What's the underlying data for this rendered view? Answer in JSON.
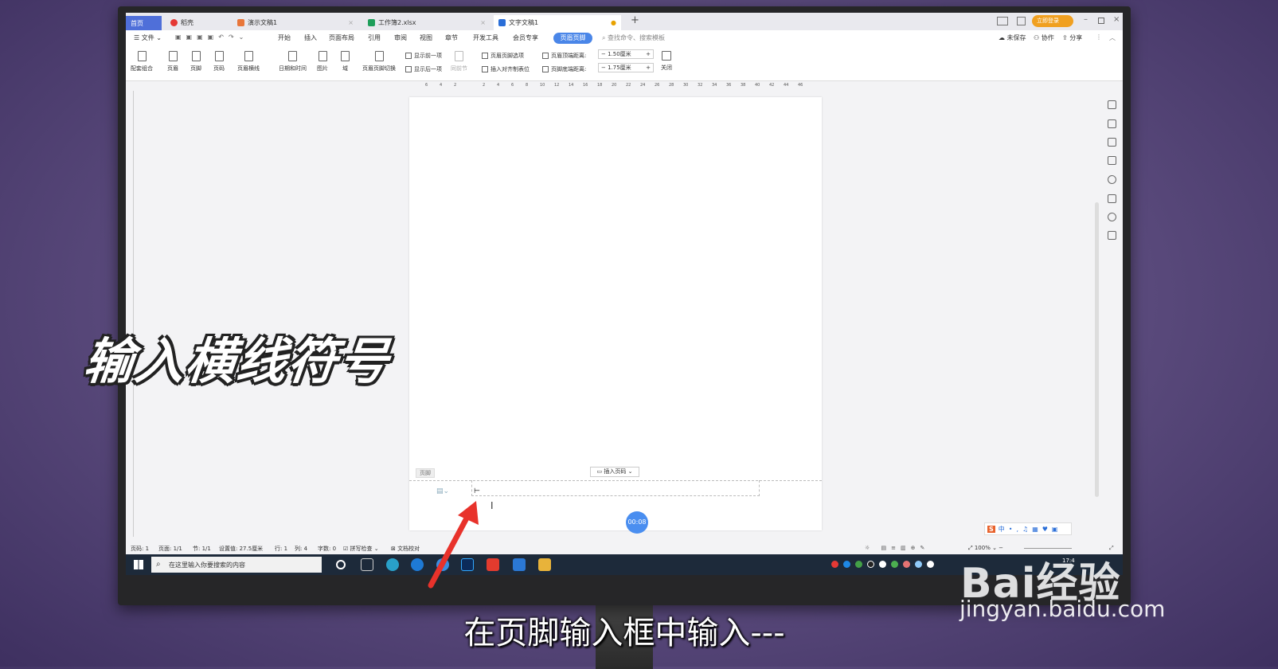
{
  "tabs": [
    {
      "label": "首页",
      "color": "#4f6fd9"
    },
    {
      "label": "稻壳",
      "color": "#e53935"
    },
    {
      "label": "演示文稿1",
      "color": "#e8763a"
    },
    {
      "label": "工作簿2.xlsx",
      "color": "#1e9e5a"
    },
    {
      "label": "文字文稿1",
      "color": "#2a6ed8"
    }
  ],
  "titlebar": {
    "login_label": "立即登录",
    "new_tab": "+"
  },
  "menu": {
    "file": "文件",
    "items": [
      "开始",
      "插入",
      "页面布局",
      "引用",
      "审阅",
      "视图",
      "章节",
      "开发工具",
      "会员专享"
    ],
    "active_tab": "页眉页脚",
    "search": "查找命令、搜索模板",
    "unsaved": "未保存",
    "collab": "协作",
    "share": "分享"
  },
  "ribbon": {
    "big_buttons": [
      "配套组合",
      "页眉",
      "页脚",
      "页码",
      "页眉横线",
      "日期和时间",
      "图片",
      "域",
      "页眉页脚切换"
    ],
    "show_prev": "显示前一项",
    "show_next": "显示后一项",
    "same_prev": "同前节",
    "hf_options": "页眉页脚选项",
    "insert_align_tab": "插入对齐制表位",
    "header_top_label": "页眉顶端距离:",
    "header_top_value": "1.50厘米",
    "footer_bottom_label": "页脚底端距离:",
    "footer_bottom_value": "1.75厘米",
    "close": "关闭"
  },
  "ruler_ticks": [
    "6",
    "4",
    "2",
    "2",
    "4",
    "6",
    "8",
    "10",
    "12",
    "14",
    "16",
    "18",
    "20",
    "22",
    "24",
    "26",
    "28",
    "30",
    "32",
    "34",
    "36",
    "38",
    "40",
    "42",
    "44",
    "46"
  ],
  "document": {
    "footer_tag": "页脚",
    "insert_page_number": "插入页码",
    "timer": "00:08"
  },
  "statusbar": {
    "page_num": "页码: 1",
    "pages": "页面: 1/1",
    "section": "节: 1/1",
    "setting": "设置值: 27.5厘米",
    "row": "行: 1",
    "col": "列: 4",
    "words": "字数: 0",
    "spell": "拼写检查",
    "proof": "文档校对",
    "zoom": "100%"
  },
  "taskbar": {
    "search_placeholder": "在这里输入你要搜索的内容",
    "time": "17:4"
  },
  "overlay": {
    "title": "输入横线符号",
    "subtitle": "在页脚输入框中输入---",
    "watermark": "Bai经验",
    "watermark_url": "jingyan.baidu.com",
    "arrow_color": "#e8322b"
  }
}
